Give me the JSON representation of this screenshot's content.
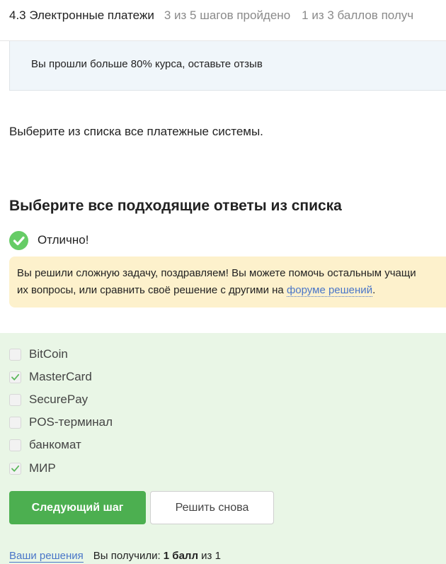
{
  "header": {
    "lesson_title": "4.3 Электронные платежи",
    "steps_progress": "3 из 5 шагов пройдено",
    "score_progress": "1 из 3 баллов  получ"
  },
  "review_banner": {
    "text": "Вы прошли больше 80% курса, оставьте отзыв"
  },
  "question": {
    "text": "Выберите из списка все платежные системы.",
    "heading": "Выберите все подходящие ответы из списка"
  },
  "result": {
    "status_text": "Отлично!",
    "status_icon": "check-circle-icon",
    "status_color": "#66cc66"
  },
  "hint": {
    "line1": "Вы решили сложную задачу, поздравляем! Вы можете помочь остальным учащи",
    "line2_prefix": "их вопросы, или сравнить своё решение с другими на ",
    "link_text": "форуме решений",
    "line2_suffix": "."
  },
  "options": [
    {
      "label": "BitCoin",
      "checked": false
    },
    {
      "label": "MasterCard",
      "checked": true
    },
    {
      "label": "SecurePay",
      "checked": false
    },
    {
      "label": "POS-терминал",
      "checked": false
    },
    {
      "label": "банкомат",
      "checked": false
    },
    {
      "label": "МИР",
      "checked": true
    }
  ],
  "buttons": {
    "next": "Следующий шаг",
    "retry": "Решить снова"
  },
  "footer": {
    "solutions_link": "Ваши решения",
    "score_prefix": "Вы получили: ",
    "score_value": "1 балл",
    "score_suffix": " из 1"
  },
  "colors": {
    "accent_green": "#4caf50",
    "answers_background": "#e9f6e6",
    "hint_background": "#fdf1cc",
    "banner_background": "#f0f6fa",
    "link": "#4a76c8"
  }
}
